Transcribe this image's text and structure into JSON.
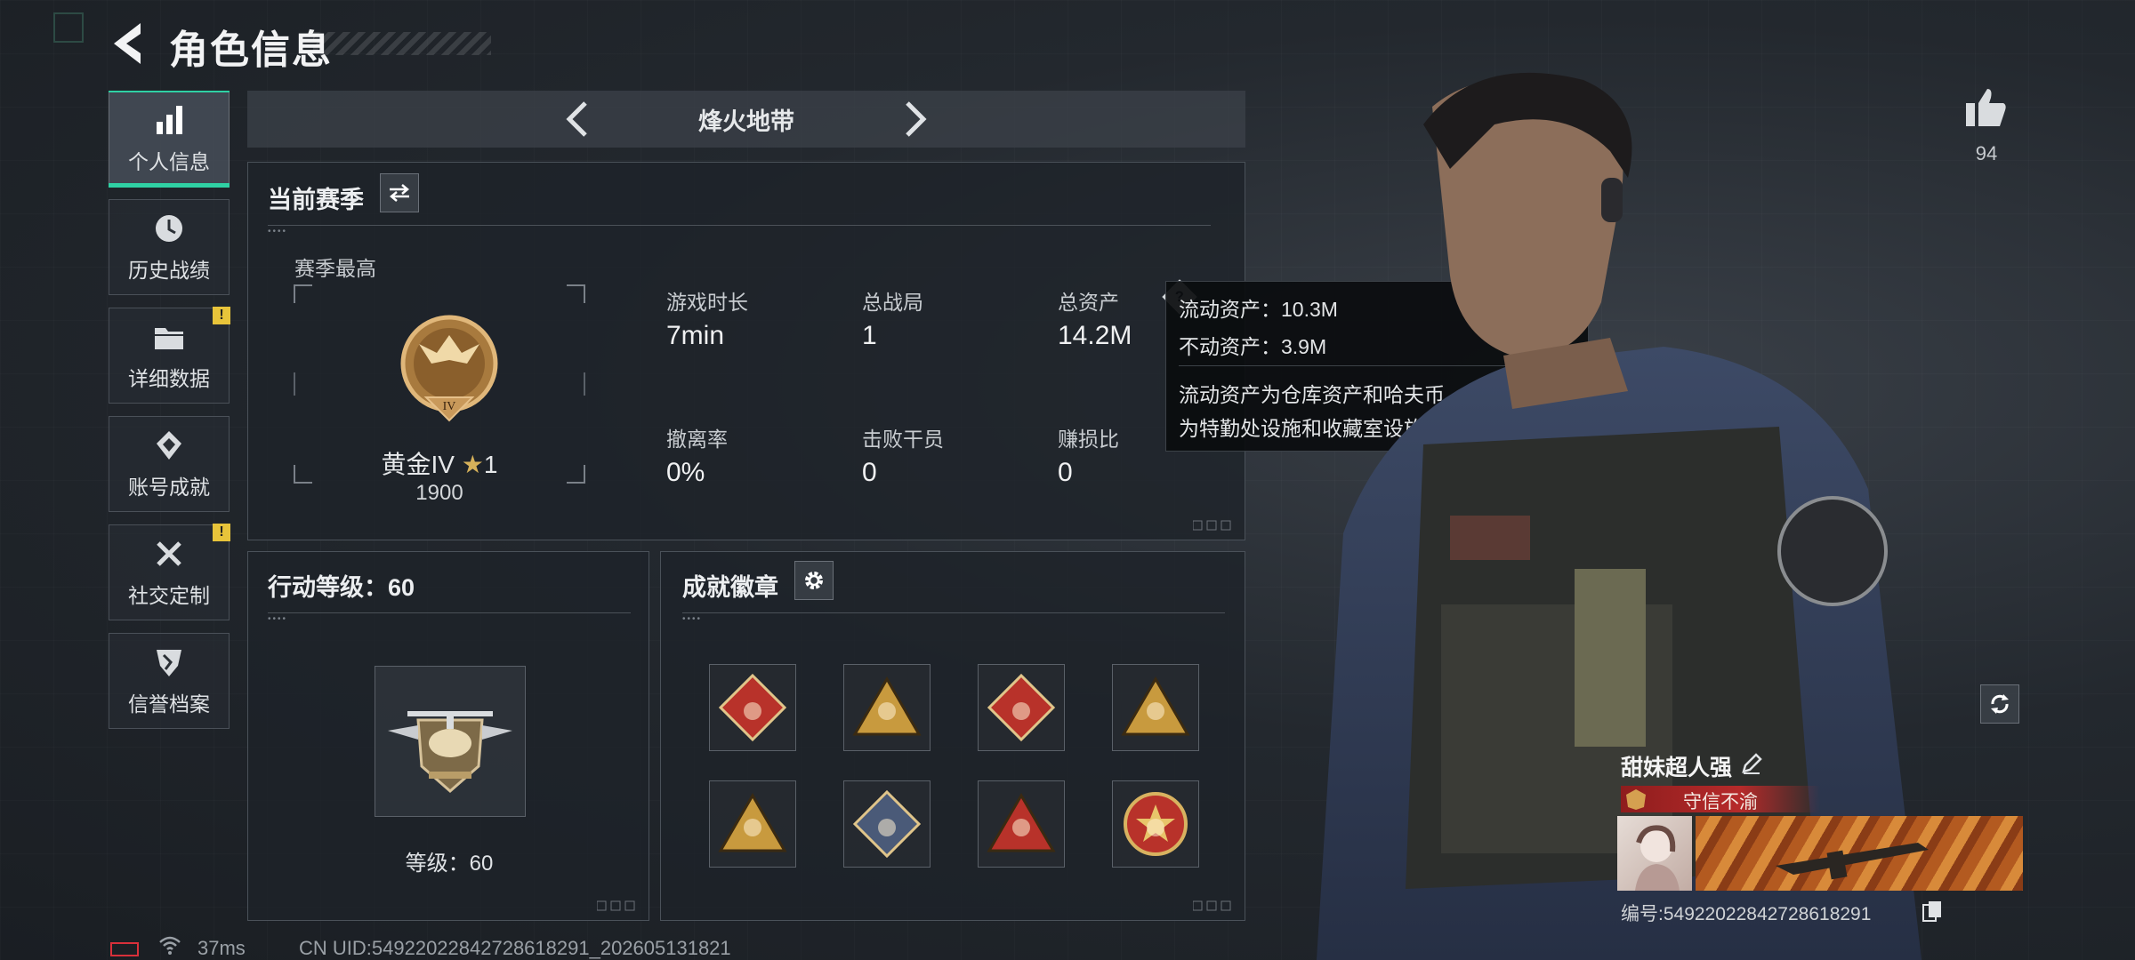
{
  "header": {
    "title": "角色信息"
  },
  "sidebar": {
    "items": [
      {
        "label": "个人信息",
        "icon": "bar-chart-icon",
        "active": true,
        "alert": false
      },
      {
        "label": "历史战绩",
        "icon": "clock-history-icon",
        "active": false,
        "alert": false
      },
      {
        "label": "详细数据",
        "icon": "folder-icon",
        "active": false,
        "alert": true
      },
      {
        "label": "账号成就",
        "icon": "diamond-badge-icon",
        "active": false,
        "alert": false
      },
      {
        "label": "社交定制",
        "icon": "tools-icon",
        "active": false,
        "alert": true
      },
      {
        "label": "信誉档案",
        "icon": "shield-icon",
        "active": false,
        "alert": false
      }
    ],
    "alert_mark": "!"
  },
  "mode": {
    "name": "烽火地带"
  },
  "season": {
    "title": "当前赛季",
    "best_label": "赛季最高",
    "rank_name": "黄金IV",
    "rank_stars": "1",
    "rank_points": "1900",
    "rank_badge_numeral": "IV",
    "stats": [
      {
        "label": "游戏时长",
        "value": "7min"
      },
      {
        "label": "总战局",
        "value": "1"
      },
      {
        "label": "总资产",
        "value": "14.2M"
      },
      {
        "label": "撤离率",
        "value": "0%"
      },
      {
        "label": "击败干员",
        "value": "0"
      },
      {
        "label": "赚损比",
        "value": "0"
      }
    ]
  },
  "tooltip": {
    "line1": "流动资产：10.3M",
    "line2": "不动资产：3.9M",
    "desc_line1": "流动资产为仓库资产和哈夫币，不动资产",
    "desc_line2": "为特勤处设施和收藏室设施"
  },
  "action_level": {
    "title": "行动等级：60",
    "level_text": "等级：60"
  },
  "achievements": {
    "title": "成就徽章",
    "badges": [
      {
        "icon": "runner-badge-icon",
        "shape": "diamond",
        "color": "#b8322a"
      },
      {
        "icon": "bag-badge-icon",
        "shape": "triangle",
        "color": "#c89a3e"
      },
      {
        "icon": "dragon-badge-icon",
        "shape": "diamond",
        "color": "#b8322a"
      },
      {
        "icon": "helmet-badge-icon",
        "shape": "triangle",
        "color": "#c89a3e"
      },
      {
        "icon": "soldiers-badge-icon",
        "shape": "triangle",
        "color": "#c89a3e"
      },
      {
        "icon": "rifle-badge-icon",
        "shape": "diamond",
        "color": "#4a5a78"
      },
      {
        "icon": "number-one-badge-icon",
        "shape": "triangle",
        "color": "#b8322a"
      },
      {
        "icon": "star-emblem-badge-icon",
        "shape": "circle",
        "color": "#b8322a"
      }
    ]
  },
  "likes": {
    "count": "94"
  },
  "player": {
    "name": "甜妹超人强",
    "title_tag": "守信不渝",
    "id_text": "编号:5492202284272861829​1"
  },
  "status": {
    "ping": "37ms",
    "uid": "CN UID:54922022842728618291_202605131821"
  }
}
